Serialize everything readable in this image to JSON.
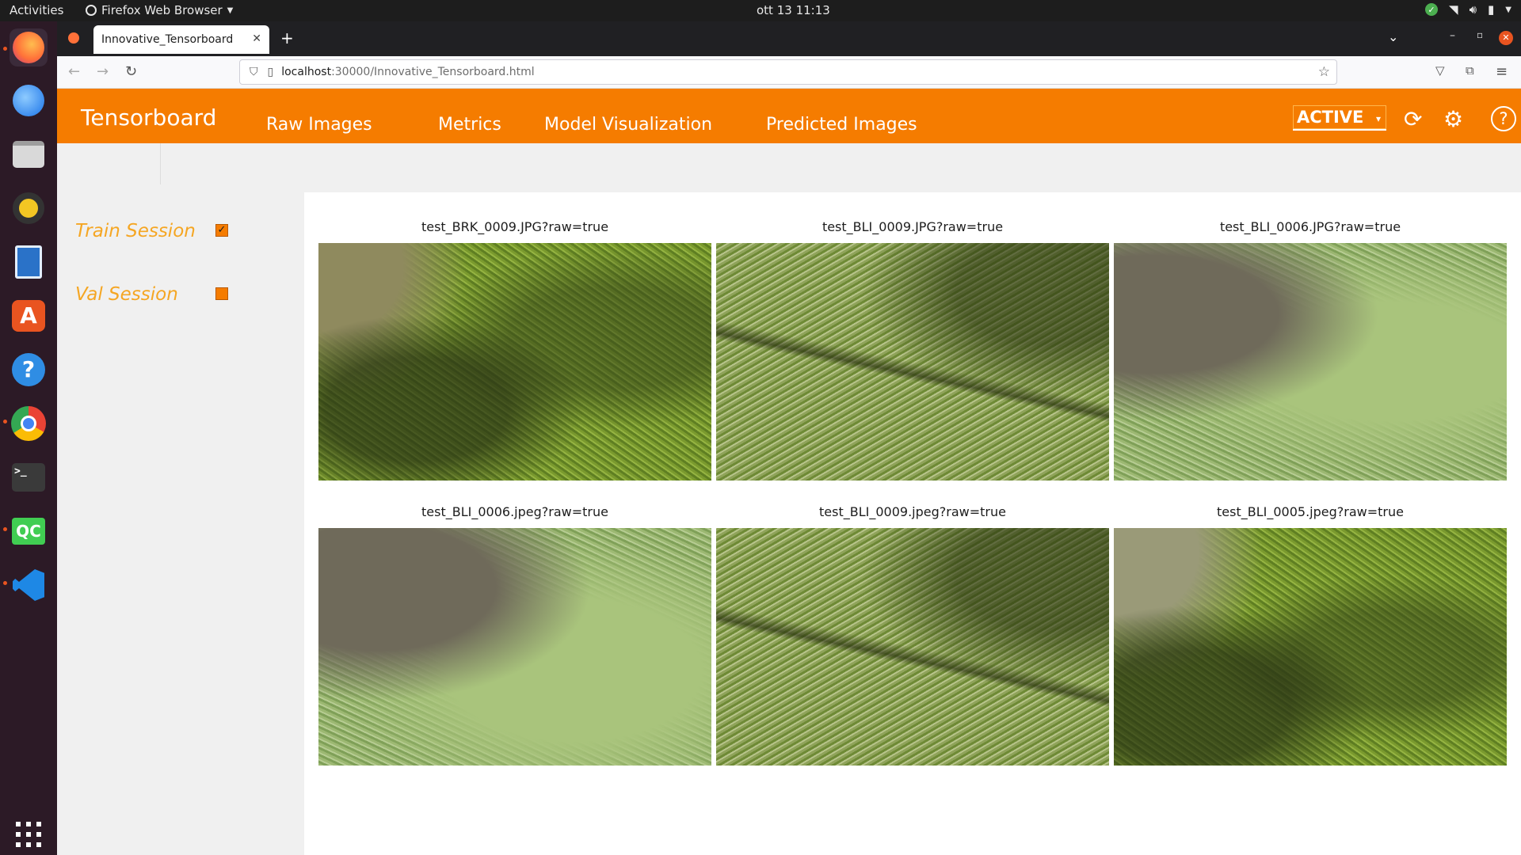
{
  "os": {
    "activities": "Activities",
    "app_menu": "Firefox Web Browser",
    "clock": "ott 13  11:13"
  },
  "browser": {
    "tab_title": "Innovative_Tensorboard",
    "url_host": "localhost",
    "url_rest": ":30000/Innovative_Tensorboard.html"
  },
  "app": {
    "brand": "Tensorboard",
    "menu": [
      "Raw Images",
      "Metrics",
      "Model Visualization",
      "Predicted Images"
    ],
    "status": "ACTIVE",
    "accent": "#f57c00"
  },
  "sidebar": {
    "sessions": [
      {
        "label": "Train Session",
        "checked": true
      },
      {
        "label": "Val Session",
        "checked": false
      }
    ]
  },
  "images": [
    {
      "caption": "test_BRK_0009.JPG?raw=true"
    },
    {
      "caption": "test_BLI_0009.JPG?raw=true"
    },
    {
      "caption": "test_BLI_0006.JPG?raw=true"
    },
    {
      "caption": "test_BLI_0006.jpeg?raw=true"
    },
    {
      "caption": "test_BLI_0009.jpeg?raw=true"
    },
    {
      "caption": "test_BLI_0005.jpeg?raw=true"
    }
  ]
}
